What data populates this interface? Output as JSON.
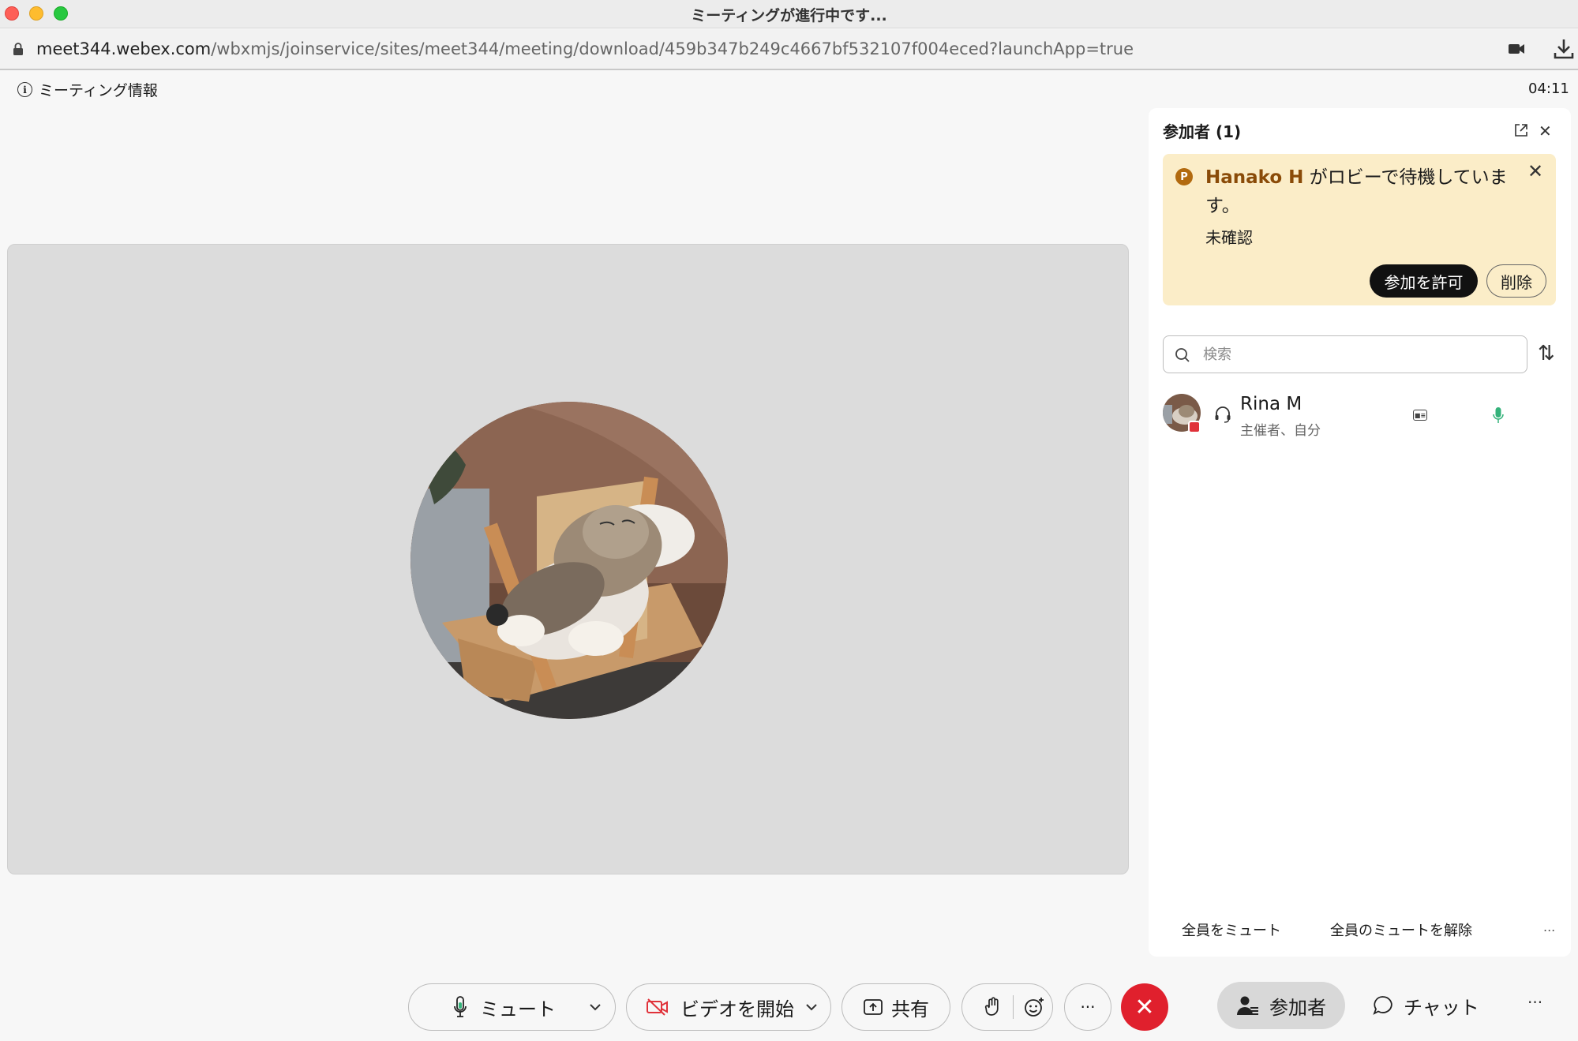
{
  "window": {
    "title": "ミーティングが進行中です..."
  },
  "address": {
    "host": "meet344.webex.com",
    "path": "/wbxmjs/joinservice/sites/meet344/meeting/download/459b347b249c4667bf532107f004eced?launchApp=true"
  },
  "meeting": {
    "info_label": "ミーティング情報",
    "timer": "04:11"
  },
  "panel": {
    "title": "参加者 (1)",
    "lobby": {
      "name": "Hanako H",
      "message": " がロビーで待機しています。",
      "status": "未確認",
      "admit_label": "参加を許可",
      "remove_label": "削除"
    },
    "search": {
      "placeholder": "検索",
      "value": ""
    },
    "participants": [
      {
        "name": "Rina M",
        "role": "主催者、自分"
      }
    ],
    "footer": {
      "mute_all": "全員をミュート",
      "unmute_all": "全員のミュートを解除",
      "more": "..."
    }
  },
  "controls": {
    "mute_label": "ミュート",
    "video_label": "ビデオを開始",
    "share_label": "共有",
    "more_label": "···",
    "participants_label": "参加者",
    "chat_label": "チャット",
    "bar_more": "···"
  },
  "colors": {
    "accent_end": "#e0202d",
    "lobby_bg": "#fbedc8",
    "mic_active": "#34b27a"
  }
}
